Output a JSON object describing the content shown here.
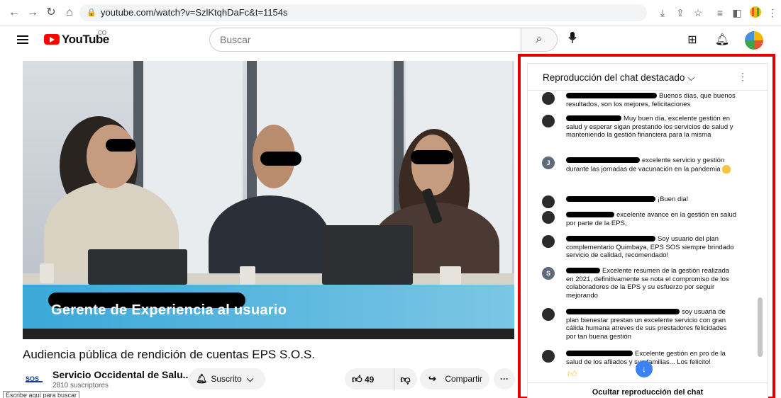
{
  "browser": {
    "url": "youtube.com/watch?v=SzlKtqhDaFc&t=1154s"
  },
  "header": {
    "logo_text": "YouTube",
    "logo_suffix": "CO",
    "search_placeholder": "Buscar"
  },
  "video": {
    "lower_third_title": "Gerente de Experiencia al usuario",
    "title": "Audiencia pública de rendición de cuentas EPS S.O.S."
  },
  "channel": {
    "logo_text": "SOS",
    "name": "Servicio Occidental de Salu...",
    "subscribers": "2810 suscriptores",
    "subscribe_label": "Suscrito"
  },
  "actions": {
    "likes": "49",
    "share_label": "Compartir",
    "more_label": "···"
  },
  "tooltip": "Escribe aquí para buscar",
  "chat": {
    "header_label": "Reproducción del chat destacado",
    "hide_label": "Ocultar reproducción del chat",
    "messages": [
      {
        "avatar": "",
        "text": "Buenos días, que buenos resultados, son los mejores, felicitaciones"
      },
      {
        "avatar": "",
        "text": "Muy buen día, excelente gestión en salud y esperar sigan prestando los servicios de salud y manteniendo la gestión financiera para la misma"
      },
      {
        "avatar": "J",
        "text": "excelente servicio y gestión durante las jornadas de vacunación en la pandemia"
      },
      {
        "avatar": "",
        "text": "¡Buen dia!"
      },
      {
        "avatar": "",
        "text": "excelente avance en la gestión en salud por parte de la EPS,"
      },
      {
        "avatar": "",
        "text": "Soy usuario del plan complementario Quimbaya, EPS SOS siempre brindado servicio de calidad, recomendado!"
      },
      {
        "avatar": "S",
        "text": "Excelente resumen de la gestión realizada en 2021, definitivamente se nota el compromiso de los colaboradores de la EPS y su esfuerzo por seguir mejorando"
      },
      {
        "avatar": "",
        "text": "soy usuaria de plan bienestar prestan un excelente servicio con gran cálida humana atreves de sus prestadores felicidades por tan buena gestión"
      },
      {
        "avatar": "",
        "text": "Excelente gestión en pro de la salud de los afiiados y sus familias... Los felicito!"
      }
    ]
  },
  "colors": {
    "highlight_border": "#e00000",
    "youtube_red": "#ff0000",
    "lower_third_blue": "#3aa8d8"
  }
}
